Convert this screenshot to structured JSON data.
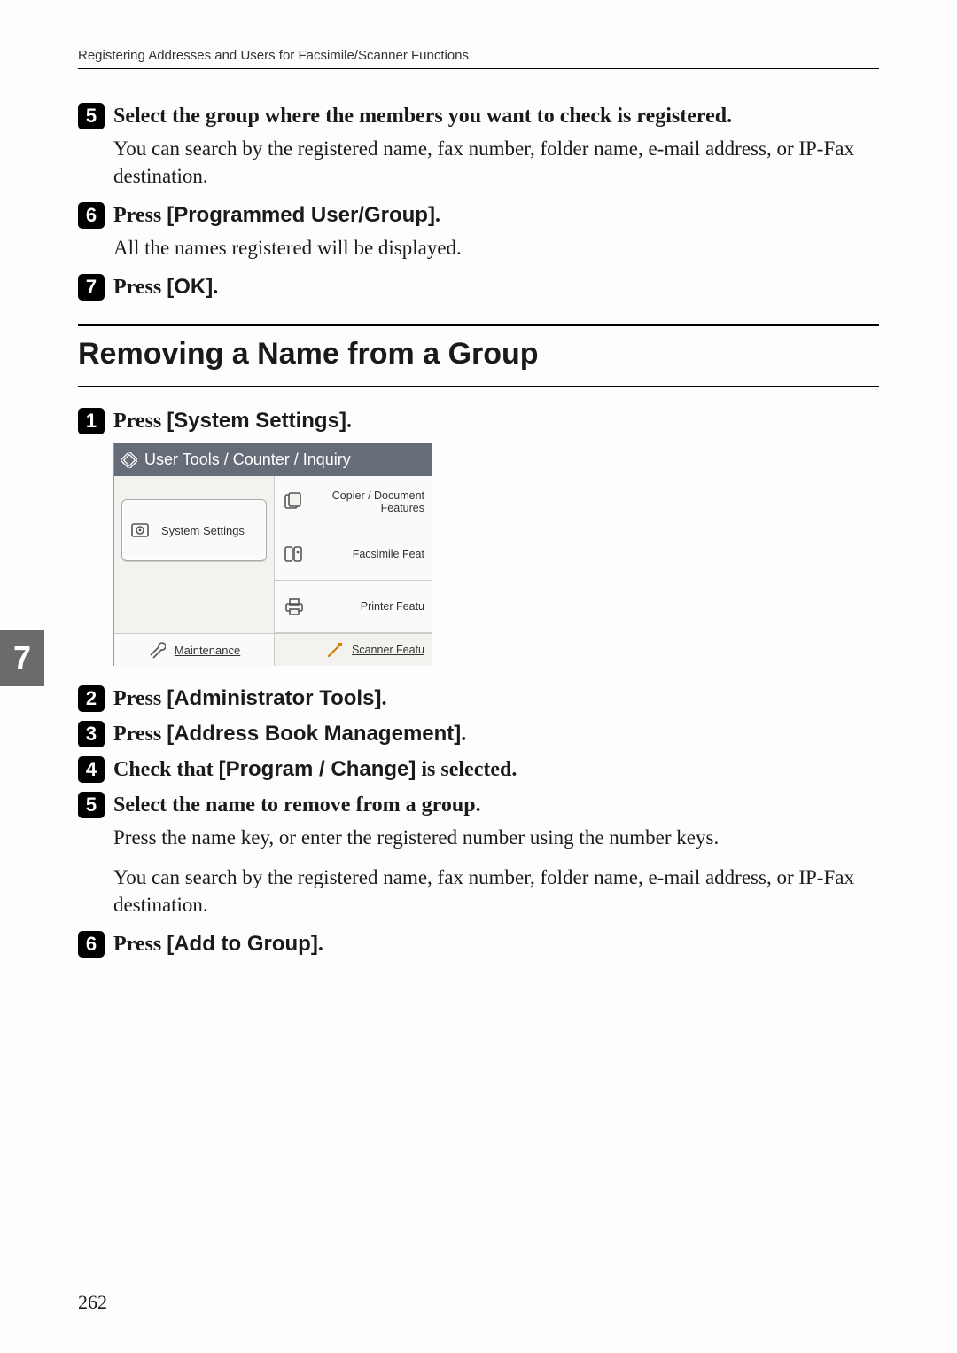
{
  "header": "Registering Addresses and Users for Facsimile/Scanner Functions",
  "side_tab": "7",
  "page_number": "262",
  "top_steps": {
    "s5": {
      "num": "5",
      "title": "Select the group where the members you want to check is registered.",
      "body": "You can search by the registered name, fax number, folder name, e-mail address, or IP-Fax destination."
    },
    "s6": {
      "num": "6",
      "title_pre": "Press ",
      "title_sans": "[Programmed User/Group]",
      "title_post": ".",
      "body": "All the names registered will be displayed."
    },
    "s7": {
      "num": "7",
      "title_pre": "Press ",
      "title_sans": "[OK]",
      "title_post": "."
    }
  },
  "section_title": "Removing a Name from a Group",
  "bottom_steps": {
    "s1": {
      "num": "1",
      "title_pre": "Press ",
      "title_sans": "[System Settings]",
      "title_post": "."
    },
    "s2": {
      "num": "2",
      "title_pre": "Press ",
      "title_sans": "[Administrator Tools]",
      "title_post": "."
    },
    "s3": {
      "num": "3",
      "title_pre": "Press ",
      "title_sans": "[Address Book Management]",
      "title_post": "."
    },
    "s4": {
      "num": "4",
      "title_pre": "Check that ",
      "title_sans": "[Program / Change]",
      "title_post": " is selected."
    },
    "s5": {
      "num": "5",
      "title": "Select the name to remove from a group.",
      "body1": "Press the name key, or enter the registered number using the number keys.",
      "body2": "You can search by the registered name, fax number, folder name, e-mail address, or IP-Fax destination."
    },
    "s6": {
      "num": "6",
      "title_pre": "Press ",
      "title_sans": "[Add to Group]",
      "title_post": "."
    }
  },
  "shot": {
    "title": "User Tools / Counter / Inquiry",
    "system_settings": "System Settings",
    "copier": "Copier / Document Features",
    "fax": "Facsimile Feat",
    "printer": "Printer Featu",
    "maintenance": "Maintenance",
    "scanner": "Scanner Featu"
  }
}
